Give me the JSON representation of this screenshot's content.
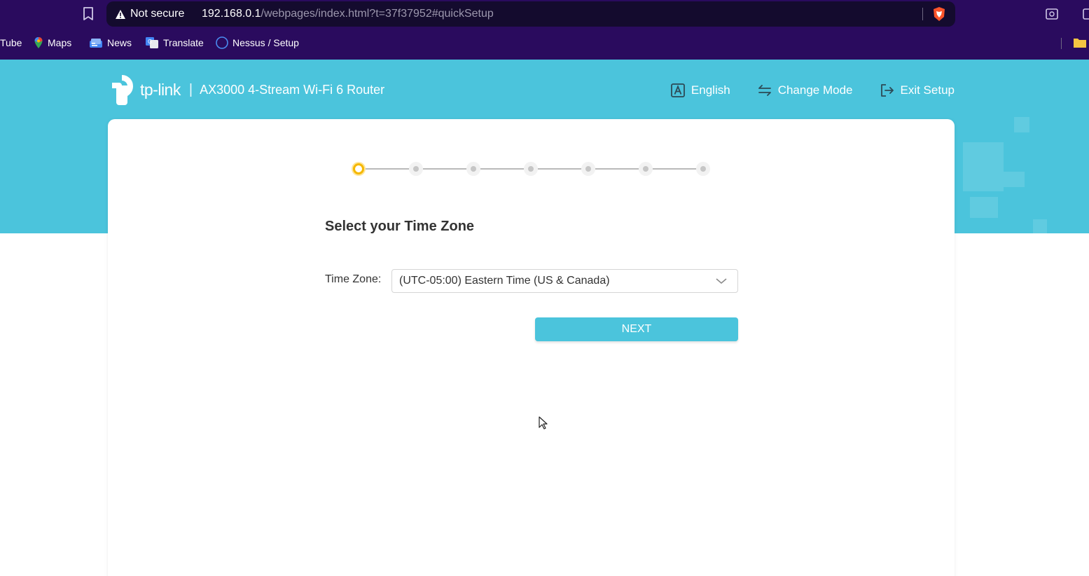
{
  "browser": {
    "security_label": "Not secure",
    "url_host": "192.168.0.1",
    "url_path": "/webpages/index.html?t=37f37952#quickSetup",
    "bookmarks": [
      {
        "label": "Tube",
        "icon": "youtube-icon"
      },
      {
        "label": "Maps",
        "icon": "maps-pin-icon"
      },
      {
        "label": "News",
        "icon": "news-icon"
      },
      {
        "label": "Translate",
        "icon": "translate-icon"
      },
      {
        "label": "Nessus / Setup",
        "icon": "globe-icon"
      }
    ],
    "colors": {
      "chrome_bg": "#2a0b5e",
      "address_bg": "#140b2e"
    }
  },
  "router": {
    "brand": "tp-link",
    "model": "AX3000 4-Stream Wi-Fi 6 Router",
    "actions": {
      "language": "English",
      "change_mode": "Change Mode",
      "exit_setup": "Exit Setup"
    },
    "steps": {
      "total": 7,
      "current": 1
    },
    "colors": {
      "brand_cyan": "#4bc4dc",
      "active_step": "#f5b800"
    }
  },
  "setup": {
    "title": "Select your Time Zone",
    "timezone_label": "Time Zone:",
    "timezone_value": "(UTC-05:00) Eastern Time (US & Canada)",
    "next_label": "NEXT"
  }
}
